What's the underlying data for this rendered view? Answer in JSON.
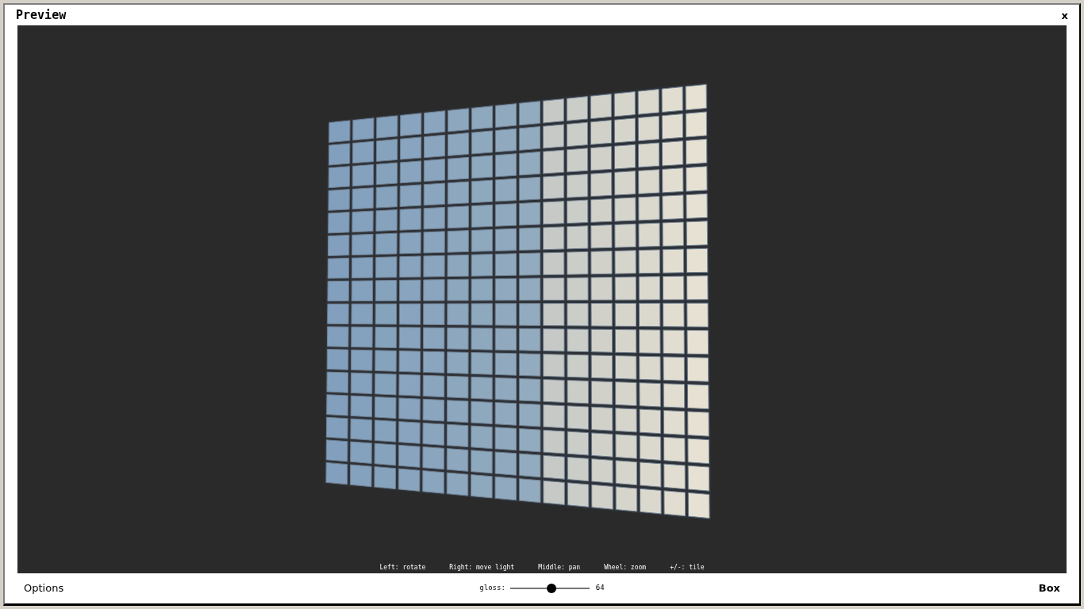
{
  "window": {
    "title": "Preview",
    "close": "x"
  },
  "hints": [
    "Left: rotate",
    "Right: move light",
    "Middle: pan",
    "Wheel: zoom",
    "+/-: tile"
  ],
  "footer": {
    "options": "Options",
    "gloss": {
      "label": "gloss:",
      "level": 0.52,
      "reading": "64"
    },
    "shape": "Box"
  }
}
